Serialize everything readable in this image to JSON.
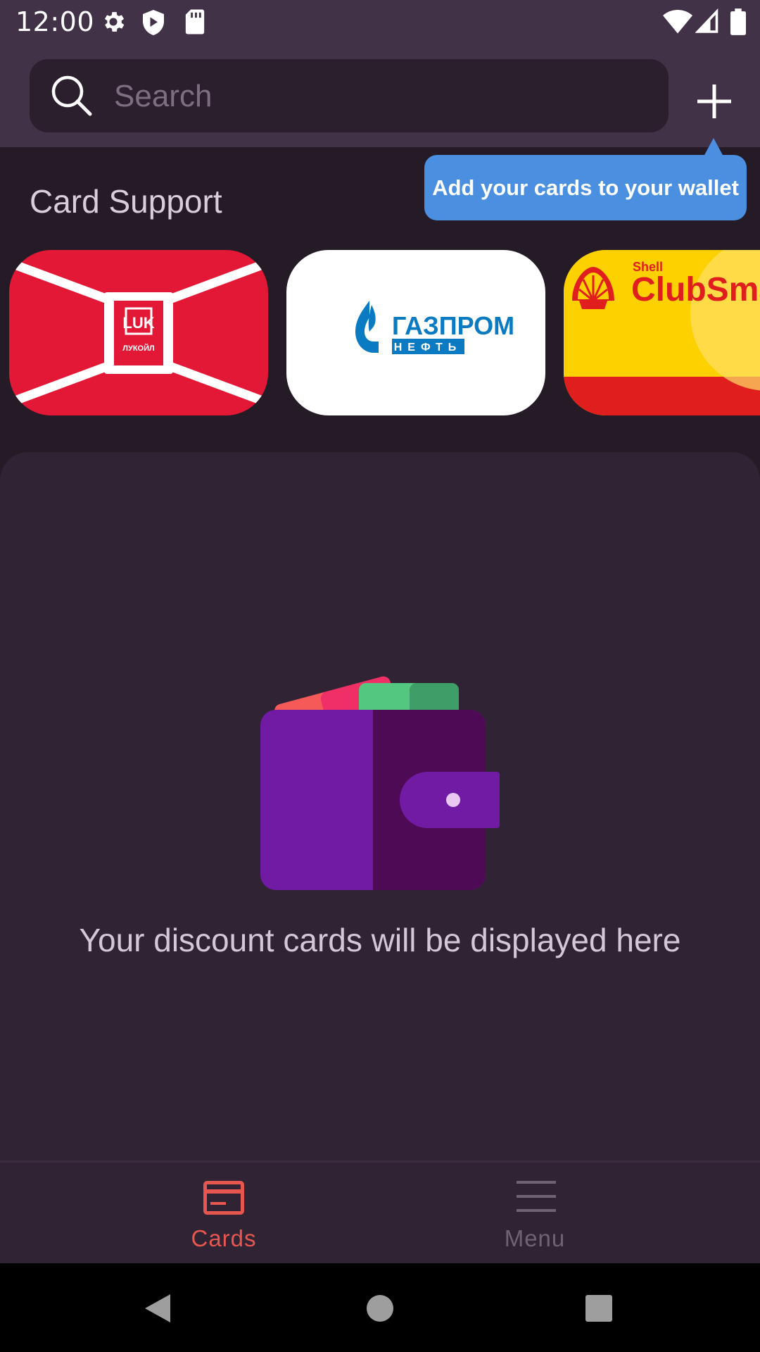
{
  "status_bar": {
    "time": "12:00",
    "icons": [
      "settings-icon",
      "shield-icon",
      "sd-card-icon",
      "wifi-icon",
      "signal-icon",
      "battery-icon"
    ]
  },
  "search": {
    "placeholder": "Search",
    "value": ""
  },
  "add_button": {
    "icon": "plus-icon"
  },
  "tooltip": {
    "text": "Add your cards to your wallet",
    "color": "#4b8fe0"
  },
  "card_support": {
    "title": "Card Support",
    "cards": [
      {
        "logo_text": "ЛУКОЙЛ",
        "color": "#e31837"
      },
      {
        "logo_text": "ГАЗПРОМ",
        "sub_text": "НЕФТЬ",
        "color": "#ffffff"
      },
      {
        "brand_text": "Shell",
        "logo_text": "ClubSma",
        "color": "#fdd000"
      }
    ]
  },
  "empty_state": {
    "icon": "wallet-icon",
    "message": "Your discount cards will be displayed here"
  },
  "bottom_nav": {
    "items": [
      {
        "label": "Cards",
        "icon": "card-icon",
        "active": true,
        "color": "#e8574f"
      },
      {
        "label": "Menu",
        "icon": "menu-icon",
        "active": false,
        "color": "#6f6373"
      }
    ]
  },
  "system_nav": {
    "buttons": [
      "back-icon",
      "home-icon",
      "recents-icon"
    ]
  }
}
